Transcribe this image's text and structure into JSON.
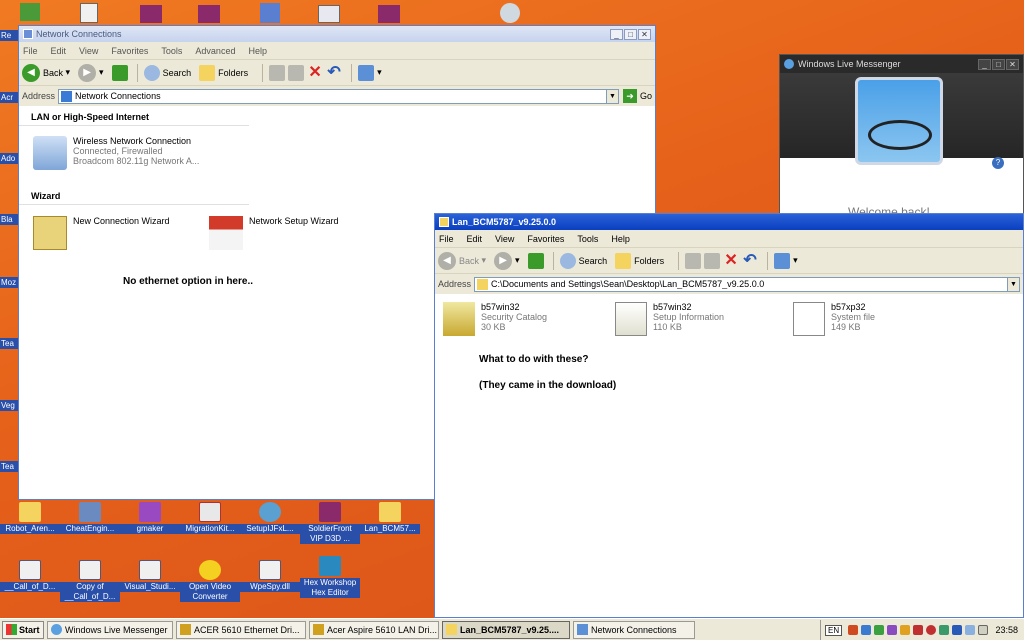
{
  "desktop_icons_bottom": [
    {
      "label": "Robot_Aren..."
    },
    {
      "label": "CheatEngin..."
    },
    {
      "label": "gmaker"
    },
    {
      "label": "MigrationKit..."
    },
    {
      "label": "SetupIJFxL..."
    },
    {
      "label": "SoldierFront VIP D3D ..."
    },
    {
      "label": "Lan_BCM57..."
    }
  ],
  "desktop_icons_row2": [
    {
      "label": "__Call_of_D..."
    },
    {
      "label": "Copy of __Call_of_D..."
    },
    {
      "label": "Visual_Studi..."
    },
    {
      "label": "Open Video Converter"
    },
    {
      "label": "WpeSpy.dll"
    },
    {
      "label": "Hex Workshop Hex Editor"
    }
  ],
  "desktop_edge_labels": [
    "Re",
    "Acr",
    "Ado",
    "Bla",
    "Moz",
    "Tea",
    "Veg",
    "Tea"
  ],
  "window1": {
    "title": "Network Connections",
    "menu": [
      "File",
      "Edit",
      "View",
      "Favorites",
      "Tools",
      "Advanced",
      "Help"
    ],
    "toolbar": {
      "back": "Back",
      "search": "Search",
      "folders": "Folders"
    },
    "address_label": "Address",
    "address": "Network Connections",
    "go": "Go",
    "section1": "LAN or High-Speed Internet",
    "wireless": {
      "name": "Wireless Network Connection",
      "status": "Connected, Firewalled",
      "device": "Broadcom 802.11g Network A..."
    },
    "section2": "Wizard",
    "wizard1": "New Connection Wizard",
    "wizard2": "Network Setup Wizard",
    "note": "No ethernet option in here.."
  },
  "window2": {
    "title": "Lan_BCM5787_v9.25.0.0",
    "menu": [
      "File",
      "Edit",
      "View",
      "Favorites",
      "Tools",
      "Help"
    ],
    "toolbar": {
      "back": "Back",
      "search": "Search",
      "folders": "Folders"
    },
    "address_label": "Address",
    "address": "C:\\Documents and Settings\\Sean\\Desktop\\Lan_BCM5787_v9.25.0.0",
    "files": [
      {
        "name": "b57win32",
        "type": "Security Catalog",
        "size": "30 KB"
      },
      {
        "name": "b57win32",
        "type": "Setup Information",
        "size": "110 KB"
      },
      {
        "name": "b57xp32",
        "type": "System file",
        "size": "149 KB"
      }
    ],
    "note1": "What to do with these?",
    "note2": "(They came in the download)"
  },
  "messenger": {
    "title": "Windows Live Messenger",
    "welcome": "Welcome back!",
    "help": "?"
  },
  "taskbar": {
    "start": "Start",
    "tasks": [
      "Windows Live Messenger",
      "ACER 5610 Ethernet Dri...",
      "Acer Aspire 5610 LAN Dri...",
      "Lan_BCM5787_v9.25....",
      "Network Connections"
    ],
    "lang": "EN",
    "clock": "23:58"
  }
}
